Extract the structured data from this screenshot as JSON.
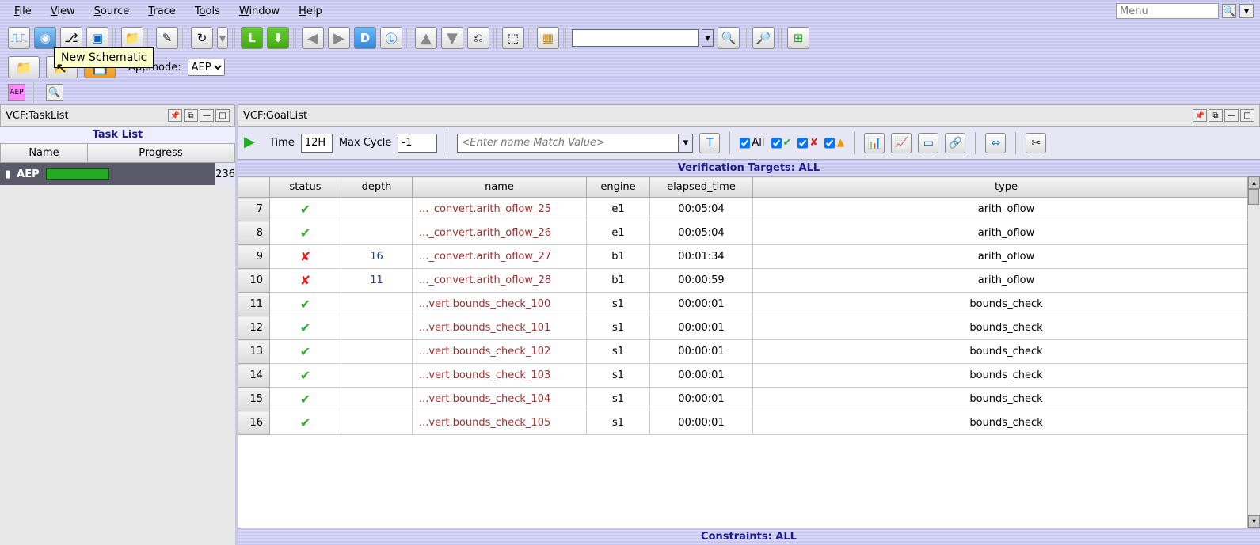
{
  "menu": {
    "items": [
      "File",
      "View",
      "Source",
      "Trace",
      "Tools",
      "Window",
      "Help"
    ],
    "search_placeholder": "Menu"
  },
  "tooltip": "New Schematic",
  "appmode": {
    "label": "Appmode:",
    "value": "AEP"
  },
  "left_panel": {
    "title": "VCF:TaskList",
    "section": "Task List",
    "cols": [
      "Name",
      "Progress"
    ],
    "row": {
      "name": "AEP",
      "count": "236"
    }
  },
  "right_panel": {
    "title": "VCF:GoalList"
  },
  "goalbar": {
    "time_label": "Time",
    "time_value": "12H",
    "maxcycle_label": "Max Cycle",
    "maxcycle_value": "-1",
    "match_placeholder": "<Enter name Match Value>",
    "all_label": "All"
  },
  "verif": {
    "label": "Verification Targets: ",
    "value": "ALL"
  },
  "constraints": {
    "label": "Constraints: ",
    "value": "ALL"
  },
  "columns": [
    "",
    "status",
    "depth",
    "name",
    "engine",
    "elapsed_time",
    "type"
  ],
  "rows": [
    {
      "n": "7",
      "status": "pass",
      "depth": "",
      "name": "..._convert.arith_oflow_25",
      "engine": "e1",
      "elapsed": "00:05:04",
      "type": "arith_oflow"
    },
    {
      "n": "8",
      "status": "pass",
      "depth": "",
      "name": "..._convert.arith_oflow_26",
      "engine": "e1",
      "elapsed": "00:05:04",
      "type": "arith_oflow"
    },
    {
      "n": "9",
      "status": "fail",
      "depth": "16",
      "name": "..._convert.arith_oflow_27",
      "engine": "b1",
      "elapsed": "00:01:34",
      "type": "arith_oflow"
    },
    {
      "n": "10",
      "status": "fail",
      "depth": "11",
      "name": "..._convert.arith_oflow_28",
      "engine": "b1",
      "elapsed": "00:00:59",
      "type": "arith_oflow"
    },
    {
      "n": "11",
      "status": "pass",
      "depth": "",
      "name": "...vert.bounds_check_100",
      "engine": "s1",
      "elapsed": "00:00:01",
      "type": "bounds_check"
    },
    {
      "n": "12",
      "status": "pass",
      "depth": "",
      "name": "...vert.bounds_check_101",
      "engine": "s1",
      "elapsed": "00:00:01",
      "type": "bounds_check"
    },
    {
      "n": "13",
      "status": "pass",
      "depth": "",
      "name": "...vert.bounds_check_102",
      "engine": "s1",
      "elapsed": "00:00:01",
      "type": "bounds_check"
    },
    {
      "n": "14",
      "status": "pass",
      "depth": "",
      "name": "...vert.bounds_check_103",
      "engine": "s1",
      "elapsed": "00:00:01",
      "type": "bounds_check"
    },
    {
      "n": "15",
      "status": "pass",
      "depth": "",
      "name": "...vert.bounds_check_104",
      "engine": "s1",
      "elapsed": "00:00:01",
      "type": "bounds_check"
    },
    {
      "n": "16",
      "status": "pass",
      "depth": "",
      "name": "...vert.bounds_check_105",
      "engine": "s1",
      "elapsed": "00:00:01",
      "type": "bounds_check"
    }
  ]
}
